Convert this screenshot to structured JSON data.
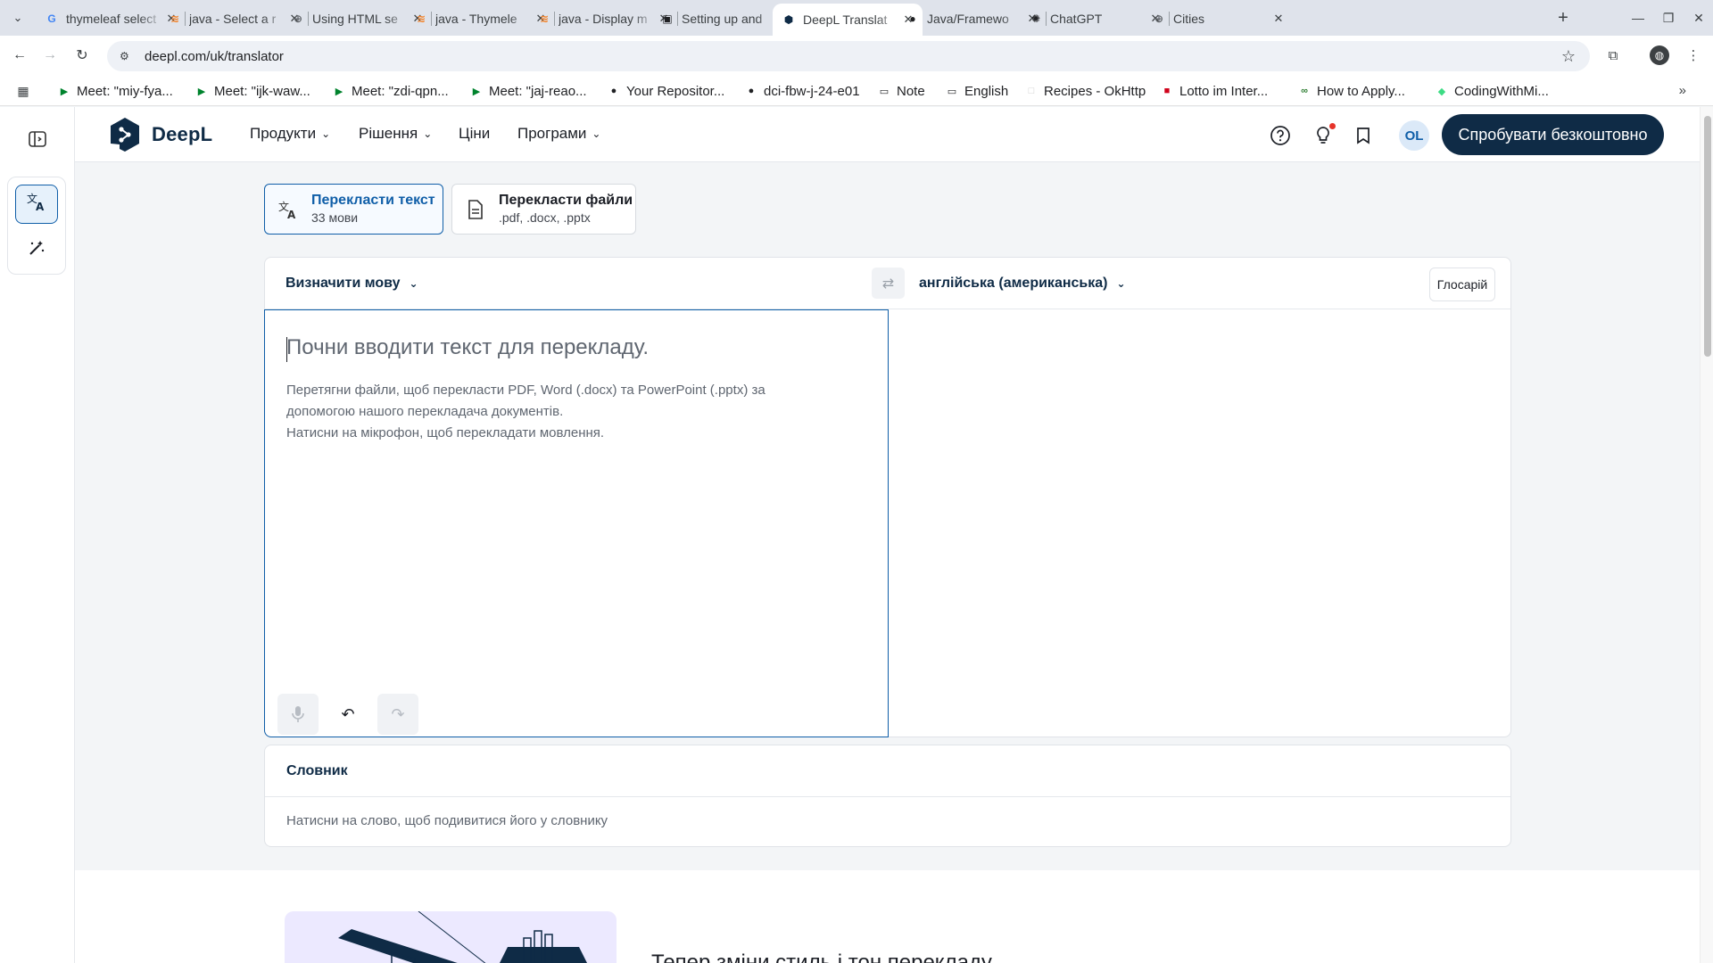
{
  "browser": {
    "tabs": [
      {
        "title": "thymeleaf select",
        "favicon": "G",
        "favicon_color": "#4285f4"
      },
      {
        "title": "java - Select a r",
        "favicon": "stack-overflow",
        "favicon_color": "#f48024"
      },
      {
        "title": "Using HTML se",
        "favicon": "globe",
        "favicon_color": "#5f6368"
      },
      {
        "title": "java - Thymele",
        "favicon": "stack-overflow",
        "favicon_color": "#f48024"
      },
      {
        "title": "java - Display m",
        "favicon": "stack-overflow",
        "favicon_color": "#f48024"
      },
      {
        "title": "Setting up and",
        "favicon": "terminal",
        "favicon_color": "#202124"
      },
      {
        "title": "DeepL Translat",
        "favicon": "deepl",
        "favicon_color": "#0f2b46",
        "active": true
      },
      {
        "title": "Java/Framewo",
        "favicon": "github",
        "favicon_color": "#202124"
      },
      {
        "title": "ChatGPT",
        "favicon": "openai",
        "favicon_color": "#202124"
      },
      {
        "title": "Cities",
        "favicon": "globe",
        "favicon_color": "#5f6368"
      }
    ],
    "url": "deepl.com/uk/translator",
    "bookmarks": [
      {
        "label": "Meet: \"miy-fya...",
        "icon": "meet"
      },
      {
        "label": "Meet: \"ijk-waw...",
        "icon": "meet"
      },
      {
        "label": "Meet: \"zdi-qpn...",
        "icon": "meet"
      },
      {
        "label": "Meet: \"jaj-reao...",
        "icon": "meet"
      },
      {
        "label": "Your Repositor...",
        "icon": "github"
      },
      {
        "label": "dci-fbw-j-24-e01",
        "icon": "github"
      },
      {
        "label": "Note",
        "icon": "folder"
      },
      {
        "label": "English",
        "icon": "folder"
      },
      {
        "label": "Recipes - OkHttp",
        "icon": "blank"
      },
      {
        "label": "Lotto im Inter...",
        "icon": "lotto"
      },
      {
        "label": "How to Apply...",
        "icon": "link"
      },
      {
        "label": "CodingWithMi...",
        "icon": "android"
      }
    ]
  },
  "site": {
    "logo_text": "DeepL",
    "nav": [
      {
        "label": "Продукти",
        "has_dropdown": true
      },
      {
        "label": "Рішення",
        "has_dropdown": true
      },
      {
        "label": "Ціни",
        "has_dropdown": false
      },
      {
        "label": "Програми",
        "has_dropdown": true
      }
    ],
    "avatar_initials": "OL",
    "cta_label": "Спробувати безкоштовно",
    "brand_color": "#0f2b46",
    "accent_color": "#0f5ea8"
  },
  "modes": [
    {
      "title": "Перекласти текст",
      "subtitle": "33 мови",
      "icon": "translate-icon",
      "active": true
    },
    {
      "title": "Перекласти файли",
      "subtitle": ".pdf, .docx, .pptx",
      "icon": "document-icon",
      "active": false
    }
  ],
  "translator": {
    "source_language": "Визначити мову",
    "target_language": "англійська (американська)",
    "glossary_label": "Глосарій",
    "placeholder": "Почни вводити текст для перекладу.",
    "hints": [
      "Перетягни файли, щоб перекласти PDF, Word (.docx) та PowerPoint (.pptx) за допомогою нашого перекладача документів.",
      "Натисни на мікрофон, щоб перекладати мовлення."
    ]
  },
  "dictionary": {
    "title": "Словник",
    "hint": "Натисни на слово, щоб подивитися його у словнику"
  },
  "promo": {
    "title": "Тепер зміни стиль і тон перекладу"
  }
}
